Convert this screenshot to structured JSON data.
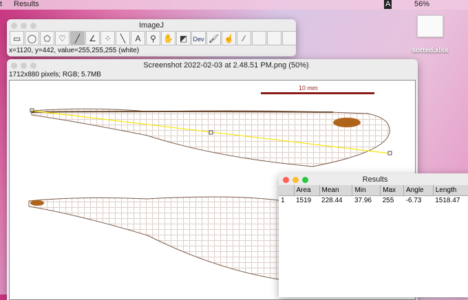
{
  "menubar": {
    "items": [
      "t",
      "Results"
    ],
    "battery": "56%",
    "input_icon": "A"
  },
  "desktop": {
    "file": "sorted.xlsx"
  },
  "imagej": {
    "title": "ImageJ",
    "tools": [
      "rectangle",
      "oval",
      "polygon",
      "freehand",
      "line",
      "angle",
      "multipoint",
      "wand",
      "text",
      "magnifier",
      "hand",
      "color-picker",
      "Dev",
      "brush",
      "hand-tool",
      "dropper",
      "",
      "",
      "",
      ">>"
    ],
    "status": "x=1120, y=442, value=255,255,255 (white)"
  },
  "image_window": {
    "title": "Screenshot 2022-02-03 at 2.48.51 PM.png (50%)",
    "info": "1712x880 pixels; RGB; 5.7MB",
    "scale_label": "10 mm"
  },
  "results": {
    "title": "Results",
    "columns": [
      "",
      "Area",
      "Mean",
      "Min",
      "Max",
      "Angle",
      "Length"
    ],
    "rows": [
      [
        "1",
        "1519",
        "228.44",
        "37.96",
        "255",
        "-6.73",
        "1518.47"
      ]
    ]
  },
  "colors": {
    "scale_bar": "#8b1a1a",
    "selection": "#f5e700",
    "close": "#ff5f57",
    "min": "#febc2e",
    "max": "#28c840"
  }
}
